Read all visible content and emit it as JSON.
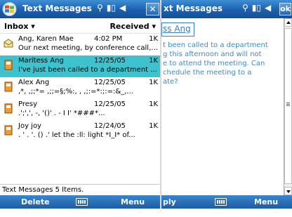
{
  "left": {
    "title": "Text Messages",
    "status_icons": [
      "antenna-icon",
      "signal-icon",
      "speaker-icon"
    ],
    "close_label": "✕",
    "folder": "Inbox ▾",
    "sort": "Received ▾",
    "messages": [
      {
        "sender": "Ang, Karen Mae",
        "date": "4:02 PM",
        "size": "1K",
        "preview": "Our next meeting, by conference call, ...",
        "icon": "envelope-open-icon",
        "selected": false
      },
      {
        "sender": "Maritess Ang",
        "date": "12/25/05",
        "size": "1K",
        "preview": "I've just been called to a department ...",
        "icon": "phone-msg-icon",
        "selected": true
      },
      {
        "sender": "Alex Ang",
        "date": "12/25/05",
        "size": "1K",
        "preview": ",*,     ,;;*=  ,;;=§;%:, , ,;:=*:;:=:&_,...",
        "icon": "phone-msg-icon",
        "selected": false
      },
      {
        "sender": "Presy",
        "date": "12/25/05",
        "size": "1K",
        "preview": ".';',',   -, '()' . -      I I'     *###*...",
        "icon": "phone-msg-icon",
        "selected": false
      },
      {
        "sender": "Joy joy",
        "date": "12/24/05",
        "size": "1K",
        "preview": ". ' . '. () .'  let the  :ll:   light *I_I*  of...",
        "icon": "phone-msg-icon",
        "selected": false
      }
    ],
    "status_line": "Text Messages  5 Items.",
    "softkey_left": "Delete",
    "softkey_right": "Menu"
  },
  "right": {
    "title": "xt Messages",
    "status_icons": [
      "antenna-icon",
      "signal-icon",
      "speaker-icon"
    ],
    "ok_label": "ok",
    "from": "ss Ang",
    "body": "t been called to a department\ng this afternoon and will not\ne to attend the meeting. Can\nchedule the meeting to a\nate?",
    "softkey_left": "ply",
    "softkey_right": "Menu"
  },
  "colors": {
    "titlebar": "#1b5fae",
    "selected_row": "#3ec3ce",
    "body_text": "#3a8cc2"
  }
}
